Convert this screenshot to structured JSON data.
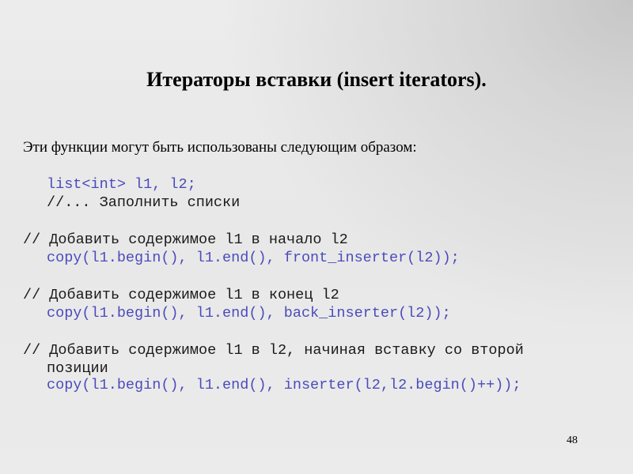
{
  "slide": {
    "title": "Итераторы вставки (insert iterators).",
    "intro": "Эти функции могут быть использованы следующим образом:",
    "code": {
      "declaration": "list<int> l1, l2;",
      "fill_comment": "//... Заполнить списки",
      "front": {
        "comment": "// Добавить содержимое l1 в начало l2",
        "code": "copy(l1.begin(), l1.end(), front_inserter(l2));"
      },
      "back": {
        "comment": "// Добавить содержимое l1 в конец l2",
        "code": "copy(l1.begin(), l1.end(), back_inserter(l2));"
      },
      "middle": {
        "comment": "// Добавить содержимое l1 в l2, начиная вставку со второй",
        "comment_continued": "позиции",
        "code": "copy(l1.begin(), l1.end(), inserter(l2,l2.begin()++));"
      }
    },
    "page_number": "48"
  },
  "colors": {
    "code_blue": "#4b4bbd",
    "text": "#000000"
  }
}
